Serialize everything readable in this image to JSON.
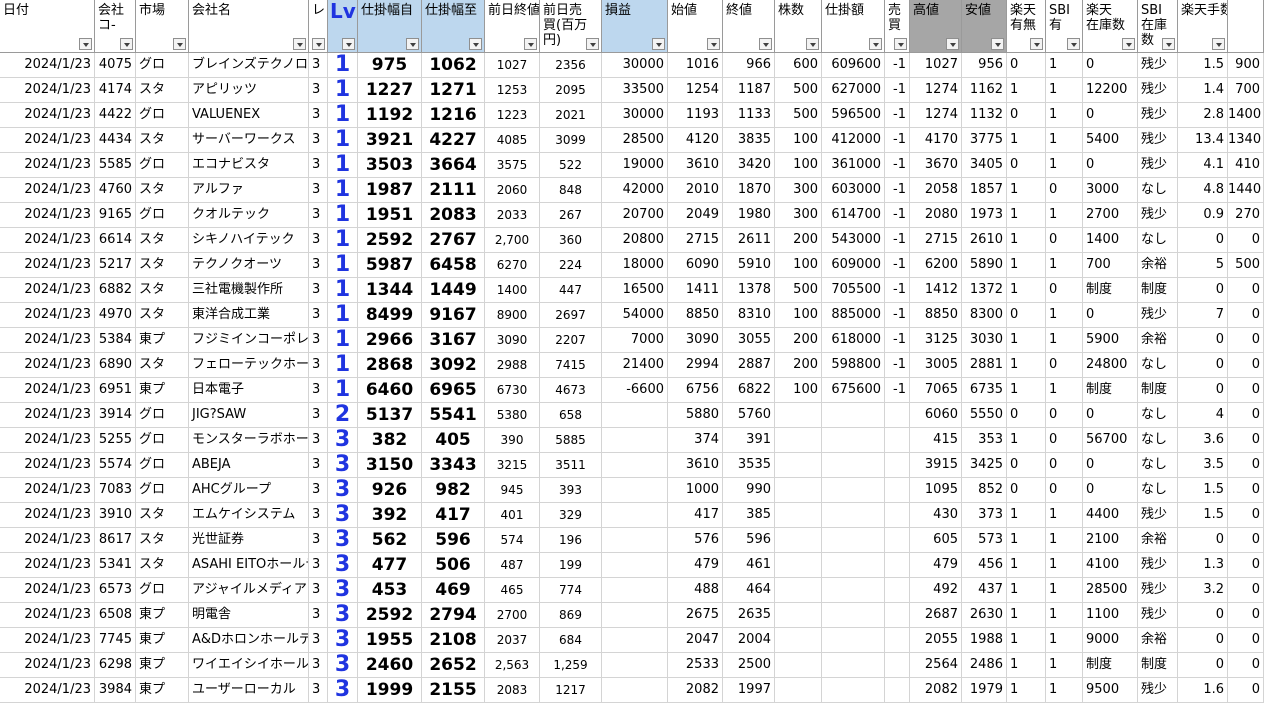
{
  "columns": [
    {
      "label": "日付"
    },
    {
      "label": "会社\nコ-"
    },
    {
      "label": "市場"
    },
    {
      "label": "会社名"
    },
    {
      "label": "レ"
    },
    {
      "label": "Lv"
    },
    {
      "label": "仕掛幅自"
    },
    {
      "label": "仕掛幅至"
    },
    {
      "label": "前日終値"
    },
    {
      "label": "前日売\n買(百万\n円)"
    },
    {
      "label": "損益"
    },
    {
      "label": "始値"
    },
    {
      "label": "終値"
    },
    {
      "label": "株数"
    },
    {
      "label": "仕掛額"
    },
    {
      "label": "売\n買"
    },
    {
      "label": "高値"
    },
    {
      "label": "安値"
    },
    {
      "label": "楽天\n有無"
    },
    {
      "label": "SBI\n有"
    },
    {
      "label": "楽天\n在庫数"
    },
    {
      "label": "SBI\n在庫\n数"
    },
    {
      "label": "楽天手数料"
    },
    {
      "label": ""
    }
  ],
  "header_colors": {
    "highlight_blue": "#bdd7ee",
    "highlight_gray": "#a6a6a6",
    "lv_blue": "#1f34e0"
  },
  "rows": [
    [
      "2024/1/23",
      "4075",
      "グロ",
      "ブレインズテクノロジー",
      "3",
      "1",
      "975",
      "1062",
      "1027",
      "2356",
      "30000",
      "1016",
      "966",
      "600",
      "609600",
      "-1",
      "1027",
      "956",
      "0",
      "1",
      "0",
      "残少",
      "1.5",
      "900"
    ],
    [
      "2024/1/23",
      "4174",
      "スタ",
      "アピリッツ",
      "3",
      "1",
      "1227",
      "1271",
      "1253",
      "2095",
      "33500",
      "1254",
      "1187",
      "500",
      "627000",
      "-1",
      "1274",
      "1162",
      "1",
      "1",
      "12200",
      "残少",
      "1.4",
      "700"
    ],
    [
      "2024/1/23",
      "4422",
      "グロ",
      "VALUENEX",
      "3",
      "1",
      "1192",
      "1216",
      "1223",
      "2021",
      "30000",
      "1193",
      "1133",
      "500",
      "596500",
      "-1",
      "1274",
      "1132",
      "0",
      "1",
      "0",
      "残少",
      "2.8",
      "1400"
    ],
    [
      "2024/1/23",
      "4434",
      "スタ",
      "サーバーワークス",
      "3",
      "1",
      "3921",
      "4227",
      "4085",
      "3099",
      "28500",
      "4120",
      "3835",
      "100",
      "412000",
      "-1",
      "4170",
      "3775",
      "1",
      "1",
      "5400",
      "残少",
      "13.4",
      "1340"
    ],
    [
      "2024/1/23",
      "5585",
      "グロ",
      "エコナビスタ",
      "3",
      "1",
      "3503",
      "3664",
      "3575",
      "522",
      "19000",
      "3610",
      "3420",
      "100",
      "361000",
      "-1",
      "3670",
      "3405",
      "0",
      "1",
      "0",
      "残少",
      "4.1",
      "410"
    ],
    [
      "2024/1/23",
      "4760",
      "スタ",
      "アルファ",
      "3",
      "1",
      "1987",
      "2111",
      "2060",
      "848",
      "42000",
      "2010",
      "1870",
      "300",
      "603000",
      "-1",
      "2058",
      "1857",
      "1",
      "0",
      "3000",
      "なし",
      "4.8",
      "1440"
    ],
    [
      "2024/1/23",
      "9165",
      "グロ",
      "クオルテック",
      "3",
      "1",
      "1951",
      "2083",
      "2033",
      "267",
      "20700",
      "2049",
      "1980",
      "300",
      "614700",
      "-1",
      "2080",
      "1973",
      "1",
      "1",
      "2700",
      "残少",
      "0.9",
      "270"
    ],
    [
      "2024/1/23",
      "6614",
      "スタ",
      "シキノハイテック",
      "3",
      "1",
      "2592",
      "2767",
      "2,700",
      "360",
      "20800",
      "2715",
      "2611",
      "200",
      "543000",
      "-1",
      "2715",
      "2610",
      "1",
      "0",
      "1400",
      "なし",
      "0",
      "0"
    ],
    [
      "2024/1/23",
      "5217",
      "スタ",
      "テクノクオーツ",
      "3",
      "1",
      "5987",
      "6458",
      "6270",
      "224",
      "18000",
      "6090",
      "5910",
      "100",
      "609000",
      "-1",
      "6200",
      "5890",
      "1",
      "1",
      "700",
      "余裕",
      "5",
      "500"
    ],
    [
      "2024/1/23",
      "6882",
      "スタ",
      "三社電機製作所",
      "3",
      "1",
      "1344",
      "1449",
      "1400",
      "447",
      "16500",
      "1411",
      "1378",
      "500",
      "705500",
      "-1",
      "1412",
      "1372",
      "1",
      "0",
      "制度",
      "制度",
      "0",
      "0"
    ],
    [
      "2024/1/23",
      "4970",
      "スタ",
      "東洋合成工業",
      "3",
      "1",
      "8499",
      "9167",
      "8900",
      "2697",
      "54000",
      "8850",
      "8310",
      "100",
      "885000",
      "-1",
      "8850",
      "8300",
      "0",
      "1",
      "0",
      "残少",
      "7",
      "0"
    ],
    [
      "2024/1/23",
      "5384",
      "東プ",
      "フジミインコーポレーテッド",
      "3",
      "1",
      "2966",
      "3167",
      "3090",
      "2207",
      "7000",
      "3090",
      "3055",
      "200",
      "618000",
      "-1",
      "3125",
      "3030",
      "1",
      "1",
      "5900",
      "余裕",
      "0",
      "0"
    ],
    [
      "2024/1/23",
      "6890",
      "スタ",
      "フェローテックホールディングス",
      "3",
      "1",
      "2868",
      "3092",
      "2988",
      "7415",
      "21400",
      "2994",
      "2887",
      "200",
      "598800",
      "-1",
      "3005",
      "2881",
      "1",
      "0",
      "24800",
      "なし",
      "0",
      "0"
    ],
    [
      "2024/1/23",
      "6951",
      "東プ",
      "日本電子",
      "3",
      "1",
      "6460",
      "6965",
      "6730",
      "4673",
      "-6600",
      "6756",
      "6822",
      "100",
      "675600",
      "-1",
      "7065",
      "6735",
      "1",
      "1",
      "制度",
      "制度",
      "0",
      "0"
    ],
    [
      "2024/1/23",
      "3914",
      "グロ",
      "JIG?SAW",
      "3",
      "2",
      "5137",
      "5541",
      "5380",
      "658",
      "",
      "5880",
      "5760",
      "",
      "",
      "",
      "6060",
      "5550",
      "0",
      "0",
      "0",
      "なし",
      "4",
      "0"
    ],
    [
      "2024/1/23",
      "5255",
      "グロ",
      "モンスターラボホールディングス",
      "3",
      "3",
      "382",
      "405",
      "390",
      "5885",
      "",
      "374",
      "391",
      "",
      "",
      "",
      "415",
      "353",
      "1",
      "0",
      "56700",
      "なし",
      "3.6",
      "0"
    ],
    [
      "2024/1/23",
      "5574",
      "グロ",
      "ABEJA",
      "3",
      "3",
      "3150",
      "3343",
      "3215",
      "3511",
      "",
      "3610",
      "3535",
      "",
      "",
      "",
      "3915",
      "3425",
      "0",
      "0",
      "0",
      "なし",
      "3.5",
      "0"
    ],
    [
      "2024/1/23",
      "7083",
      "グロ",
      "AHCグループ",
      "3",
      "3",
      "926",
      "982",
      "945",
      "393",
      "",
      "1000",
      "990",
      "",
      "",
      "",
      "1095",
      "852",
      "0",
      "0",
      "0",
      "なし",
      "1.5",
      "0"
    ],
    [
      "2024/1/23",
      "3910",
      "スタ",
      "エムケイシステム",
      "3",
      "3",
      "392",
      "417",
      "401",
      "329",
      "",
      "417",
      "385",
      "",
      "",
      "",
      "430",
      "373",
      "1",
      "1",
      "4400",
      "残少",
      "1.5",
      "0"
    ],
    [
      "2024/1/23",
      "8617",
      "スタ",
      "光世証券",
      "3",
      "3",
      "562",
      "596",
      "574",
      "196",
      "",
      "576",
      "596",
      "",
      "",
      "",
      "605",
      "573",
      "1",
      "1",
      "2100",
      "余裕",
      "0",
      "0"
    ],
    [
      "2024/1/23",
      "5341",
      "スタ",
      "ASAHI EITOホールディングス",
      "3",
      "3",
      "477",
      "506",
      "487",
      "199",
      "",
      "479",
      "461",
      "",
      "",
      "",
      "479",
      "456",
      "1",
      "1",
      "4100",
      "残少",
      "1.3",
      "0"
    ],
    [
      "2024/1/23",
      "6573",
      "グロ",
      "アジャイルメディア・ネットワーク",
      "3",
      "3",
      "453",
      "469",
      "465",
      "774",
      "",
      "488",
      "464",
      "",
      "",
      "",
      "492",
      "437",
      "1",
      "1",
      "28500",
      "残少",
      "3.2",
      "0"
    ],
    [
      "2024/1/23",
      "6508",
      "東プ",
      "明電舎",
      "3",
      "3",
      "2592",
      "2794",
      "2700",
      "869",
      "",
      "2675",
      "2635",
      "",
      "",
      "",
      "2687",
      "2630",
      "1",
      "1",
      "1100",
      "残少",
      "0",
      "0"
    ],
    [
      "2024/1/23",
      "7745",
      "東プ",
      "A&Dホロンホールディングス",
      "3",
      "3",
      "1955",
      "2108",
      "2037",
      "684",
      "",
      "2047",
      "2004",
      "",
      "",
      "",
      "2055",
      "1988",
      "1",
      "1",
      "9000",
      "余裕",
      "0",
      "0"
    ],
    [
      "2024/1/23",
      "6298",
      "東プ",
      "ワイエイシイホールディングス",
      "3",
      "3",
      "2460",
      "2652",
      "2,563",
      "1,259",
      "",
      "2533",
      "2500",
      "",
      "",
      "",
      "2564",
      "2486",
      "1",
      "1",
      "制度",
      "制度",
      "0",
      "0"
    ],
    [
      "2024/1/23",
      "3984",
      "東プ",
      "ユーザーローカル",
      "3",
      "3",
      "1999",
      "2155",
      "2083",
      "1217",
      "",
      "2082",
      "1997",
      "",
      "",
      "",
      "2082",
      "1979",
      "1",
      "1",
      "9500",
      "残少",
      "1.6",
      "0"
    ]
  ]
}
